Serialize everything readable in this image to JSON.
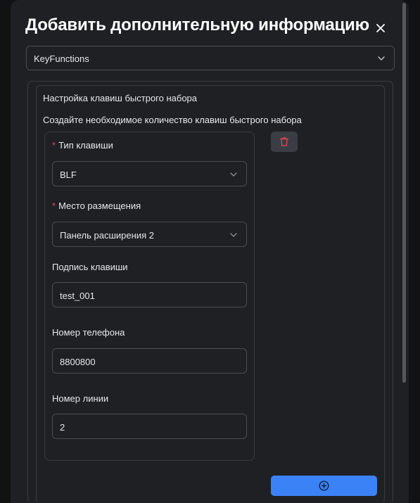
{
  "dialog": {
    "title": "Добавить дополнительную информацию",
    "close_icon": "close-icon"
  },
  "category_select": {
    "value": "KeyFunctions",
    "icon": "chevron-down-icon"
  },
  "section": {
    "heading": "Настройка клавиш быстрого набора",
    "description": "Создайте необходимое количество клавиш быстрого набора"
  },
  "key_card": {
    "key_type": {
      "label": "Тип клавиши",
      "required": true,
      "value": "BLF"
    },
    "placement": {
      "label": "Место размещения",
      "required": true,
      "value": "Панель расширения 2"
    },
    "caption": {
      "label": "Подпись клавиши",
      "value": "test_001"
    },
    "phone": {
      "label": "Номер телефона",
      "value": "8800800"
    },
    "line": {
      "label": "Номер линии",
      "value": "2"
    }
  },
  "actions": {
    "delete_icon": "trash-icon",
    "add_icon": "plus-circle-icon"
  },
  "colors": {
    "background": "#1f2023",
    "accent": "#3b82f6",
    "danger": "#e5484d",
    "required_mark": "#e5484d"
  }
}
